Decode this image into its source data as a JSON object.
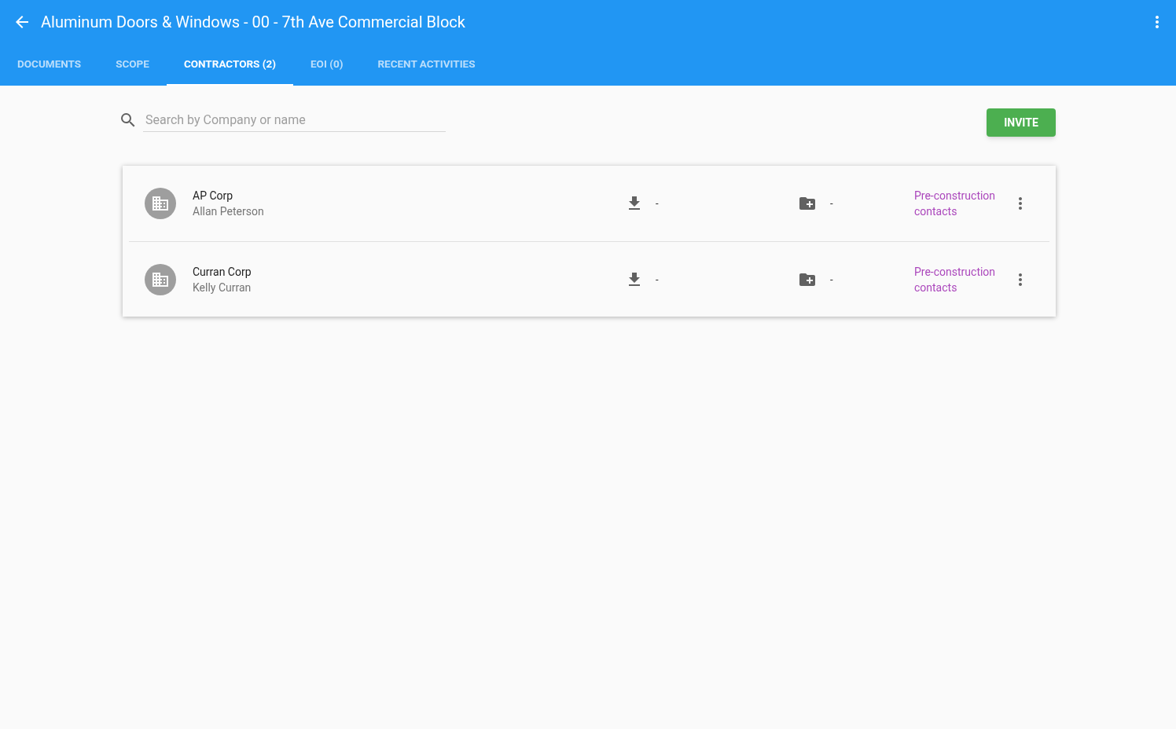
{
  "header": {
    "title": "Aluminum Doors & Windows - 00 - 7th Ave Commercial Block"
  },
  "tabs": [
    {
      "label": "DOCUMENTS",
      "selected": false
    },
    {
      "label": "SCOPE",
      "selected": false
    },
    {
      "label": "CONTRACTORS (2)",
      "selected": true
    },
    {
      "label": "EOI (0)",
      "selected": false
    },
    {
      "label": "RECENT ACTIVITIES",
      "selected": false
    }
  ],
  "search": {
    "placeholder": "Search by Company or name"
  },
  "invite_button": "INVITE",
  "contractors": [
    {
      "company": "AP Corp",
      "contact": "Allan Peterson",
      "downloads": "-",
      "folders": "-",
      "link": "Pre-construction contacts"
    },
    {
      "company": "Curran Corp",
      "contact": "Kelly Curran",
      "downloads": "-",
      "folders": "-",
      "link": "Pre-construction contacts"
    }
  ]
}
